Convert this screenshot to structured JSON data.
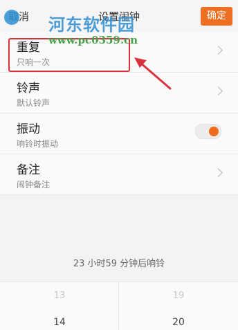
{
  "header": {
    "cancel_label": "取消",
    "title": "设置闹钟",
    "confirm_label": "确定"
  },
  "watermark": {
    "site_name": "河东软件园",
    "url": "www.pc0359.cn"
  },
  "settings": [
    {
      "label": "重复",
      "sub": "只响一次"
    },
    {
      "label": "铃声",
      "sub": "默认铃声"
    },
    {
      "label": "振动",
      "sub": "响铃时振动"
    },
    {
      "label": "备注",
      "sub": "闹钟备注"
    }
  ],
  "vibrate_enabled": true,
  "countdown_text": "23 小时59 分钟后响铃",
  "picker": {
    "hours": [
      "13",
      "14"
    ],
    "minutes": [
      "19",
      "20"
    ]
  },
  "colors": {
    "accent": "#ee6e22",
    "annotation": "#d8343d"
  }
}
